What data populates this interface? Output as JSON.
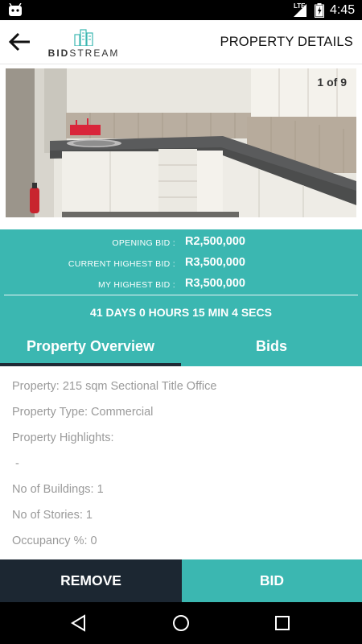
{
  "status_bar": {
    "time": "4:45",
    "network": "LTE",
    "icons": [
      "android-icon",
      "signal-icon",
      "battery-icon"
    ]
  },
  "header": {
    "title": "PROPERTY DETAILS",
    "logo_text_bold": "BID",
    "logo_text_light": "STREAM",
    "back_icon": "arrow-left-icon"
  },
  "gallery": {
    "counter": "1 of 9"
  },
  "bids": [
    {
      "label": "OPENING BID :",
      "value": "R2,500,000"
    },
    {
      "label": "CURRENT HIGHEST BID :",
      "value": "R3,500,000"
    },
    {
      "label": "MY HIGHEST BID :",
      "value": "R3,500,000"
    }
  ],
  "countdown": "41 DAYS 0 HOURS 15 MIN 4 SECS",
  "tabs": [
    {
      "label": "Property Overview",
      "active": true
    },
    {
      "label": "Bids",
      "active": false
    }
  ],
  "details": [
    "Property: 215 sqm Sectional Title Office",
    "Property Type: Commercial",
    "Property Highlights:",
    " -",
    "No of Buildings: 1",
    "No of Stories: 1",
    "Occupancy %: 0"
  ],
  "actions": {
    "remove_label": "REMOVE",
    "bid_label": "BID"
  },
  "colors": {
    "accent": "#3bb7b1",
    "dark": "#1c2732",
    "detail_text": "#9a9a9a"
  },
  "nav": [
    "back-triangle-icon",
    "home-circle-icon",
    "recents-square-icon"
  ]
}
